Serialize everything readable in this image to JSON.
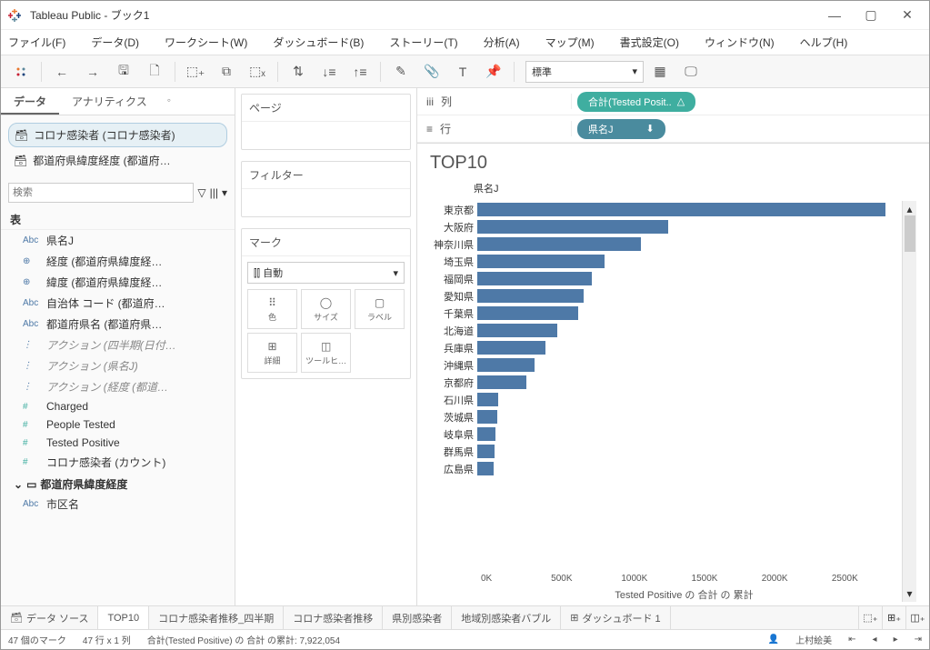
{
  "window": {
    "title": "Tableau Public - ブック1"
  },
  "menu": [
    "ファイル(F)",
    "データ(D)",
    "ワークシート(W)",
    "ダッシュボード(B)",
    "ストーリー(T)",
    "分析(A)",
    "マップ(M)",
    "書式設定(O)",
    "ウィンドウ(N)",
    "ヘルプ(H)"
  ],
  "toolbar": {
    "standard": "標準"
  },
  "left": {
    "tabs": {
      "data": "データ",
      "analytics": "アナリティクス"
    },
    "datasources": [
      {
        "label": "コロナ感染者 (コロナ感染者)",
        "selected": true
      },
      {
        "label": "都道府県緯度経度 (都道府…",
        "selected": false
      }
    ],
    "search_placeholder": "検索",
    "table_header": "表",
    "fields_dim": [
      {
        "type": "Abc",
        "label": "県名J"
      },
      {
        "type": "⊕",
        "label": "経度 (都道府県緯度経…"
      },
      {
        "type": "⊕",
        "label": "緯度 (都道府県緯度経…"
      },
      {
        "type": "Abc",
        "label": "自治体 コード (都道府…"
      },
      {
        "type": "Abc",
        "label": "都道府県名 (都道府県…"
      }
    ],
    "fields_gray": [
      {
        "type": "⋮",
        "label": "アクション (四半期(日付…"
      },
      {
        "type": "⋮",
        "label": "アクション (県名J)"
      },
      {
        "type": "⋮",
        "label": "アクション (経度 (都道…"
      }
    ],
    "fields_measure": [
      {
        "type": "#",
        "label": "Charged"
      },
      {
        "type": "#",
        "label": "People Tested"
      },
      {
        "type": "#",
        "label": "Tested Positive"
      },
      {
        "type": "#",
        "label": "コロナ感染者 (カウント)"
      }
    ],
    "folder": "都道府県緯度経度",
    "folder_fields": [
      {
        "type": "Abc",
        "label": "市区名"
      }
    ]
  },
  "cards": {
    "pages": "ページ",
    "filters": "フィルター",
    "marks": "マーク",
    "auto": "自動",
    "cells": {
      "color": "色",
      "size": "サイズ",
      "label": "ラベル",
      "detail": "詳細",
      "tooltip": "ツールヒ…"
    }
  },
  "shelves": {
    "cols": "列",
    "rows": "行",
    "col_pill": "合計(Tested Posit..",
    "row_pill": "県名J"
  },
  "viz_title": "TOP10",
  "chart_header": "県名J",
  "x_axis_label": "Tested Positive の 合計 の 累計",
  "chart_data": {
    "type": "bar",
    "orientation": "horizontal",
    "categories": [
      "東京都",
      "大阪府",
      "神奈川県",
      "埼玉県",
      "福岡県",
      "愛知県",
      "千葉県",
      "北海道",
      "兵庫県",
      "沖縄県",
      "京都府",
      "石川県",
      "茨城県",
      "岐阜県",
      "群馬県",
      "広島県"
    ],
    "values": [
      2500,
      1170,
      1000,
      780,
      700,
      650,
      620,
      490,
      420,
      350,
      300,
      130,
      120,
      110,
      105,
      100
    ],
    "xticks": [
      "0K",
      "500K",
      "1000K",
      "1500K",
      "2000K",
      "2500K"
    ],
    "xlabel": "Tested Positive の 合計 の 累計",
    "ylabel": "県名J",
    "xlim": [
      0,
      2600
    ]
  },
  "bottom_tabs": {
    "datasource": "データ ソース",
    "tabs": [
      "TOP10",
      "コロナ感染者推移_四半期",
      "コロナ感染者推移",
      "県別感染者",
      "地域別感染者バブル",
      "ダッシュボード 1"
    ]
  },
  "status": {
    "marks": "47 個のマーク",
    "rowsxcols": "47 行 x 1 列",
    "sum": "合計(Tested Positive) の 合計 の累計: 7,922,054",
    "user": "上村絵美"
  }
}
